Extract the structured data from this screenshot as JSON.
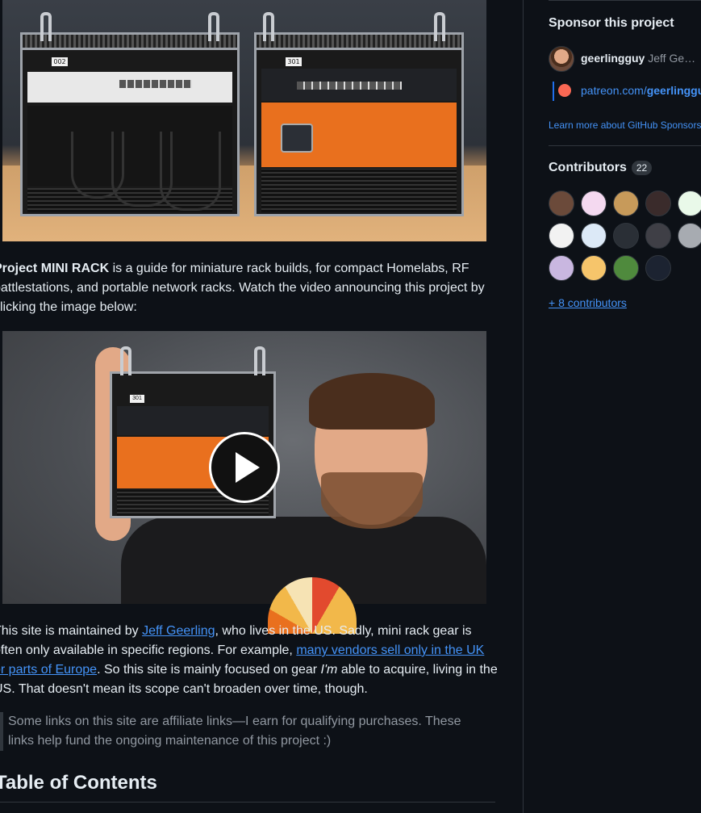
{
  "main": {
    "intro_title": "Project MINI RACK",
    "intro_lines": [
      " is a guide for miniature rack builds, for compact Homelabs, RF",
      "battlestations, and portable network racks. Watch the video announcing this project by",
      "clicking the image below:"
    ],
    "rack_tag_left": "002",
    "rack_tag_right": "301",
    "video_rack_tag": "301",
    "maintainer": {
      "lead": "This site is maintained by ",
      "author_link": "Jeff Geerling",
      "after_author": ", who lives in the US. Sadly, mini rack gear is",
      "line2": "often only available in specific regions. For example, ",
      "vendors_link_line1": "many vendors sell only in the UK",
      "vendors_link_line2": "or parts of Europe",
      "after_link": ". So this site is mainly focused on gear ",
      "emphasis": "I'm",
      "after_emphasis": " able to acquire, living in the",
      "line4": "US. That doesn't mean its scope can't broaden over time, though."
    },
    "affiliate_note_line1": "Some links on this site are affiliate links—I earn for qualifying purchases. These",
    "affiliate_note_line2": "links help fund the ongoing maintenance of this project :)",
    "toc_heading": "Table of Contents"
  },
  "sidebar": {
    "sponsor_title": "Sponsor this project",
    "sponsor_username": "geerlingguy",
    "sponsor_fullname": "Jeff Ge…",
    "patreon_prefix": "patreon.com/",
    "patreon_handle": "geerlinggu",
    "learn_more": "Learn more about GitHub Sponsors",
    "contributors_title": "Contributors",
    "contributors_count": "22",
    "more_contributors": "+ 8 contributors",
    "contributor_avatars": [
      {
        "color": "#6b4a3a",
        "name": "contributor-avatar"
      },
      {
        "color": "#f4d9f0",
        "name": "contributor-avatar"
      },
      {
        "color": "#c79a5a",
        "name": "contributor-avatar"
      },
      {
        "color": "#3a2b2b",
        "name": "contributor-avatar"
      },
      {
        "color": "#e9f9e9",
        "name": "contributor-avatar"
      },
      {
        "color": "#f2f2f2",
        "name": "contributor-avatar"
      },
      {
        "color": "#dce9f7",
        "name": "contributor-avatar"
      },
      {
        "color": "#2a2f36",
        "name": "contributor-avatar"
      },
      {
        "color": "#3f3f46",
        "name": "contributor-avatar"
      },
      {
        "color": "#a7abb1",
        "name": "contributor-avatar"
      },
      {
        "color": "#c9b7e0",
        "name": "contributor-avatar"
      },
      {
        "color": "#f6c56b",
        "name": "contributor-avatar"
      },
      {
        "color": "#4f8a3d",
        "name": "contributor-avatar"
      },
      {
        "color": "#1c2331",
        "name": "contributor-avatar"
      }
    ]
  }
}
